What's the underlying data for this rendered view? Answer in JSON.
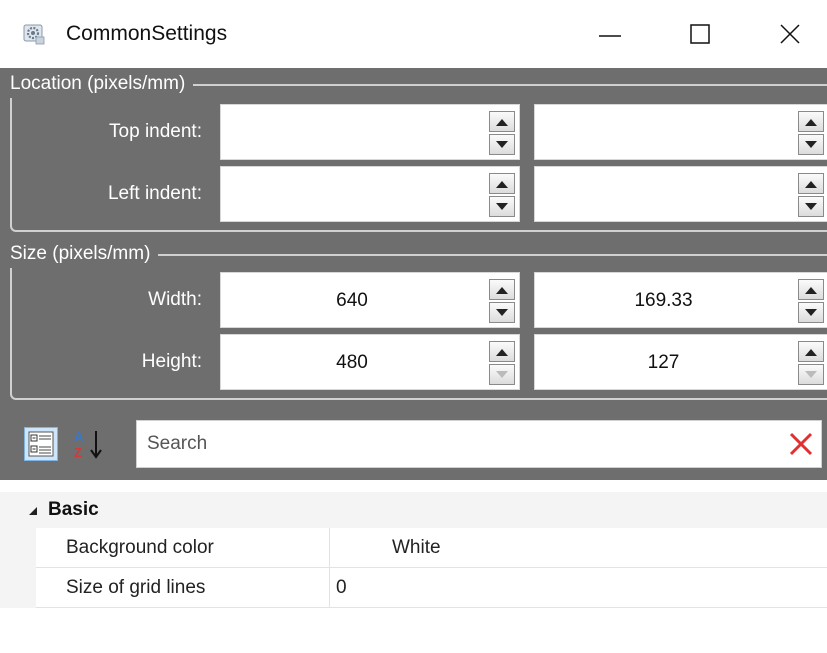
{
  "window": {
    "title": "CommonSettings",
    "controls": {
      "minimize": "minimize",
      "maximize": "maximize",
      "close": "close"
    }
  },
  "location": {
    "legend": "Location (pixels/mm)",
    "rows": [
      {
        "label": "Top indent:",
        "pixels": "",
        "mm": ""
      },
      {
        "label": "Left indent:",
        "pixels": "",
        "mm": ""
      }
    ]
  },
  "size": {
    "legend": "Size (pixels/mm)",
    "rows": [
      {
        "label": "Width:",
        "pixels": "640",
        "mm": "169.33"
      },
      {
        "label": "Height:",
        "pixels": "480",
        "mm": "127"
      }
    ]
  },
  "toolbar": {
    "categorized_icon": "categorized-view-icon",
    "alphabetical_icon": "sort-alphabetical-icon",
    "search_placeholder": "Search",
    "clear_icon": "clear-search-icon"
  },
  "property_grid": {
    "category": "Basic",
    "properties": [
      {
        "name": "Background color",
        "value": "White"
      },
      {
        "name": "Size of grid lines",
        "value": "0"
      }
    ]
  },
  "colors": {
    "panel_background": "#6e6e6e",
    "clear_icon": "#e03030",
    "group_border": "#d0d0d0"
  }
}
